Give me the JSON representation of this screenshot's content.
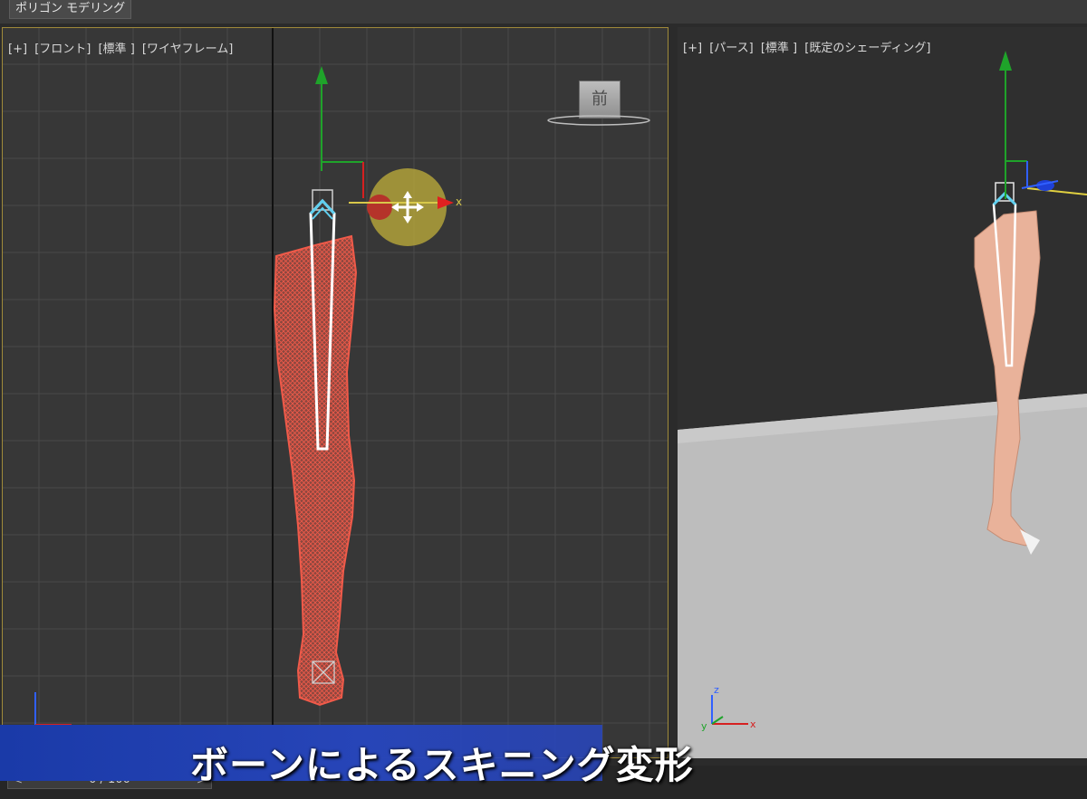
{
  "ribbon": {
    "tab_label": "ポリゴン モデリング"
  },
  "front_viewport": {
    "labels": [
      "[+]",
      "[フロント]",
      "[標準 ]",
      "[ワイヤフレーム]"
    ],
    "viewcube_label": "前",
    "gizmo_axis_label": "x"
  },
  "persp_viewport": {
    "labels": [
      "[+]",
      "[パース]",
      "[標準 ]",
      "[既定のシェーディング]"
    ]
  },
  "axis_tripod": {
    "x": "x",
    "y": "y",
    "z": "z"
  },
  "timeline": {
    "frame_text": "0 / 100",
    "prev": "<",
    "next": ">"
  },
  "subtitle": {
    "text": "ボーンによるスキニング変形"
  },
  "colors": {
    "wireframe": "#f05a4a",
    "bone": "#e9f2f5",
    "bone_highlight": "#5fd0f0",
    "gizmo_y": "#1fa32a",
    "gizmo_x": "#d62020",
    "gizmo_circle": "#b8a83a",
    "skin": "#e9b29a",
    "subtitle_band": "#1f3fb0"
  }
}
